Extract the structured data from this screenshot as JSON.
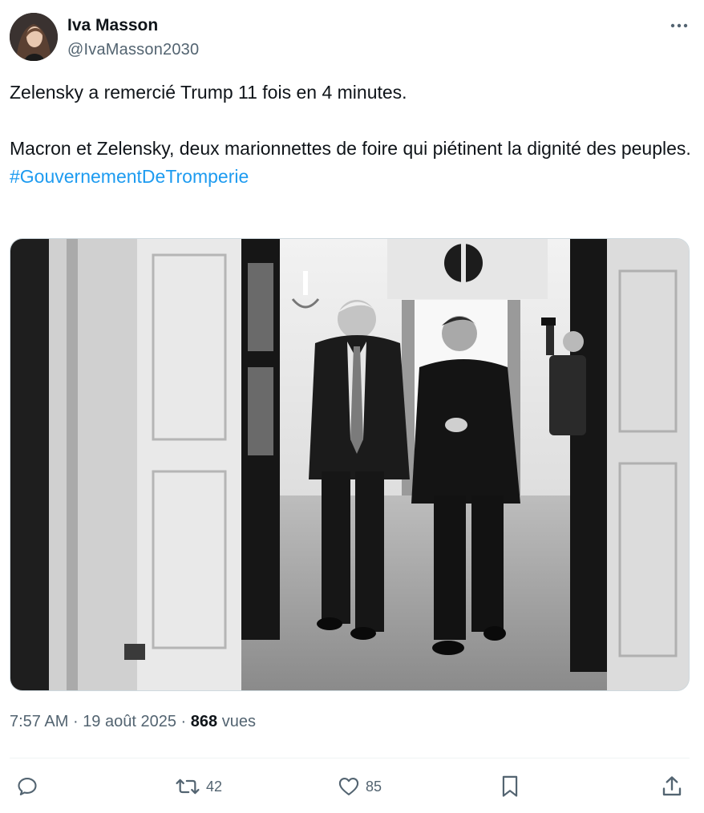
{
  "author": {
    "name": "Iva Masson",
    "handle": "@IvaMasson2030"
  },
  "tweet": {
    "line1": "Zelensky a remercié Trump 11 fois en 4 minutes.",
    "line2": "Macron et Zelensky, deux marionnettes de foire qui piétinent la dignité des peuples.",
    "hashtag": "#GouvernementDeTromperie"
  },
  "meta": {
    "time": "7:57 AM",
    "separator": "·",
    "date": "19 août 2025",
    "views_count": "868",
    "views_label": "vues"
  },
  "actions": {
    "reply": {
      "icon": "reply-icon"
    },
    "retweet": {
      "icon": "retweet-icon",
      "count": "42"
    },
    "like": {
      "icon": "heart-icon",
      "count": "85"
    },
    "bookmark": {
      "icon": "bookmark-icon"
    },
    "share": {
      "icon": "share-icon"
    }
  },
  "colors": {
    "text": "#0f1419",
    "secondary": "#536471",
    "link": "#1d9bf0",
    "divider": "#eff3f4"
  }
}
